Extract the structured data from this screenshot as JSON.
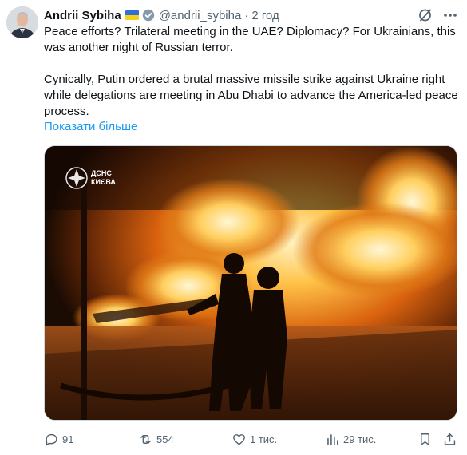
{
  "author": {
    "name": "Andrii Sybiha",
    "handle": "@andrii_sybiha",
    "separator": "·",
    "time": "2 год"
  },
  "icons": {
    "flag": "ukraine-flag-icon",
    "verified": "verified-badge-icon",
    "grok": "grok-icon",
    "more": "more-icon"
  },
  "post": {
    "paragraph1": "Peace efforts? Trilateral meeting in the UAE? Diplomacy? For Ukrainians, this was another night of Russian terror.",
    "paragraph2": "Cynically, Putin ordered a brutal massive missile strike against Ukraine right while delegations are meeting in Abu Dhabi to advance the America-led peace process.",
    "show_more": "Показати більше"
  },
  "media": {
    "watermark_line1": "ДСНС",
    "watermark_line2": "КИЄВА"
  },
  "actions": {
    "replies": "91",
    "reposts": "554",
    "likes": "1 тис.",
    "views": "29 тис."
  },
  "colors": {
    "text": "#0f1419",
    "secondary": "#536471",
    "link": "#1d9bf0"
  }
}
